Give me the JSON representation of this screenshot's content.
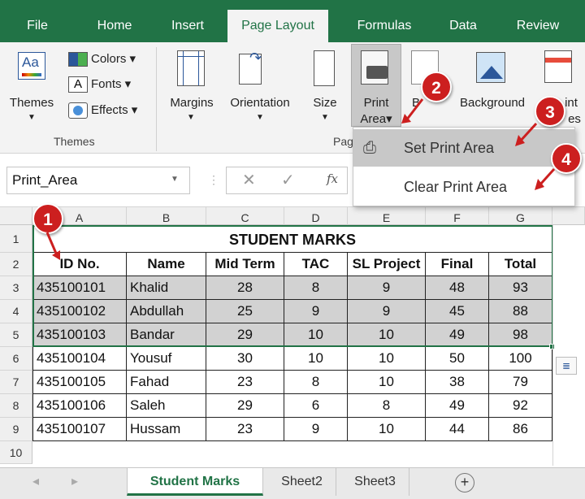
{
  "tabs": [
    "File",
    "Home",
    "Insert",
    "Page Layout",
    "Formulas",
    "Data",
    "Review"
  ],
  "ribbon": {
    "themes": "Themes",
    "colors": "Colors",
    "fonts": "Fonts",
    "effects": "Effects",
    "margins": "Margins",
    "orientation": "Orientation",
    "size": "Size",
    "print": "Print",
    "area": "Area",
    "b": "B",
    "background": "Background",
    "print_titles_a": "int",
    "print_titles_b": "es",
    "group_themes": "Themes",
    "group_page": "Pag"
  },
  "namebox": "Print_Area",
  "fx": "fx",
  "dropdown": {
    "set": "Set Print Area",
    "clear": "Clear Print Area"
  },
  "cols": [
    "A",
    "B",
    "C",
    "D",
    "E",
    "F",
    "G"
  ],
  "rows": [
    "1",
    "2",
    "3",
    "4",
    "5",
    "6",
    "7",
    "8",
    "9",
    "10"
  ],
  "title": "STUDENT MARKS",
  "headers": [
    "ID No.",
    "Name",
    "Mid Term",
    "TAC",
    "SL Project",
    "Final",
    "Total"
  ],
  "data": [
    [
      "435100101",
      "Khalid",
      "28",
      "8",
      "9",
      "48",
      "93"
    ],
    [
      "435100102",
      "Abdullah",
      "25",
      "9",
      "9",
      "45",
      "88"
    ],
    [
      "435100103",
      "Bandar",
      "29",
      "10",
      "10",
      "49",
      "98"
    ],
    [
      "435100104",
      "Yousuf",
      "30",
      "10",
      "10",
      "50",
      "100"
    ],
    [
      "435100105",
      "Fahad",
      "23",
      "8",
      "10",
      "38",
      "79"
    ],
    [
      "435100106",
      "Saleh",
      "29",
      "6",
      "8",
      "49",
      "92"
    ],
    [
      "435100107",
      "Hussam",
      "23",
      "9",
      "10",
      "44",
      "86"
    ]
  ],
  "sheets": [
    "Student Marks",
    "Sheet2",
    "Sheet3"
  ],
  "badges": [
    "1",
    "2",
    "3",
    "4"
  ],
  "colors": {
    "excel_green": "#217346",
    "badge": "#cc1f1f",
    "selection": "#d2d2d2"
  }
}
